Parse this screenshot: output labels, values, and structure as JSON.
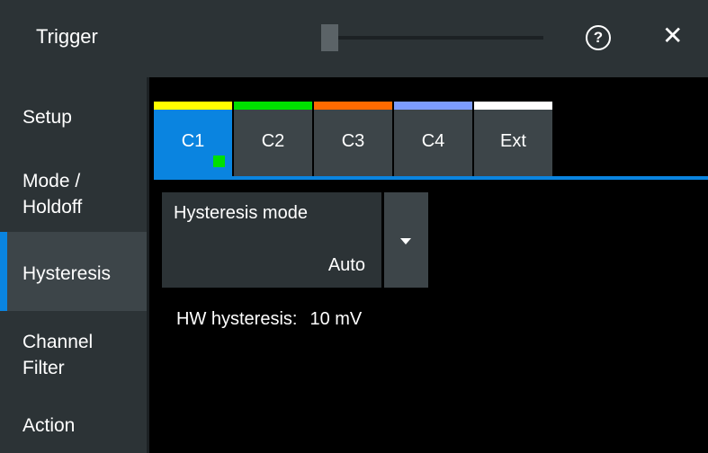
{
  "titlebar": {
    "title": "Trigger",
    "help_icon": "?",
    "close_icon": "✕"
  },
  "sidebar": {
    "items": [
      {
        "label": "Setup",
        "active": false
      },
      {
        "label": "Mode /\nHoldoff",
        "active": false
      },
      {
        "label": "Hysteresis",
        "active": true
      },
      {
        "label": "Channel\nFilter",
        "active": false
      },
      {
        "label": "Action",
        "active": false
      }
    ]
  },
  "tabs": [
    {
      "label": "C1",
      "color": "#ffff00",
      "active": true
    },
    {
      "label": "C2",
      "color": "#00e000",
      "active": false
    },
    {
      "label": "C3",
      "color": "#ff6a00",
      "active": false
    },
    {
      "label": "C4",
      "color": "#7c9cff",
      "active": false
    },
    {
      "label": "Ext",
      "color": "#ffffff",
      "active": false
    }
  ],
  "hysteresis": {
    "mode_label": "Hysteresis mode",
    "mode_value": "Auto",
    "hw_label": "HW hysteresis:",
    "hw_value": "10 mV"
  },
  "colors": {
    "accent": "#0a84e0",
    "panel": "#2c3336",
    "button": "#3d4549",
    "background": "#000000"
  }
}
